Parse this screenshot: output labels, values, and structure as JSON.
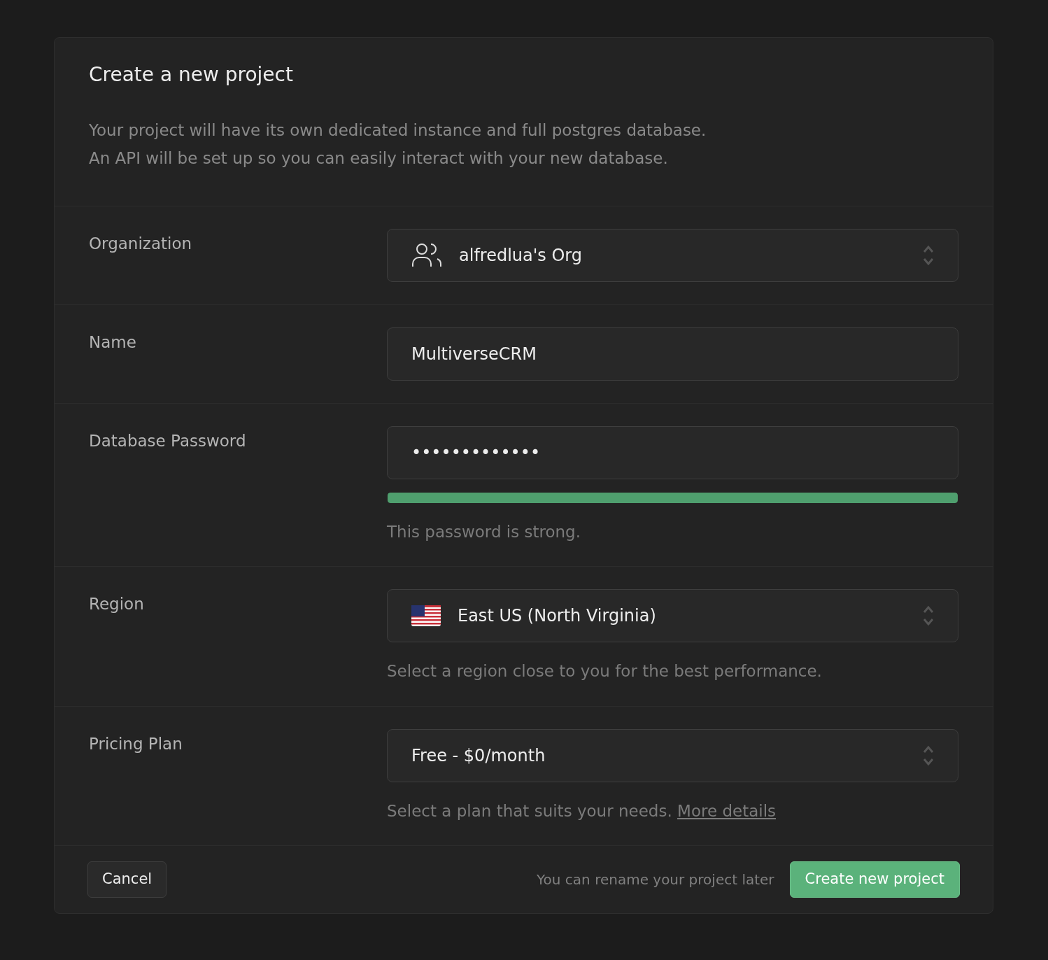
{
  "title": "Create a new project",
  "description": [
    "Your project will have its own dedicated instance and full postgres database.",
    "An API will be set up so you can easily interact with your new database."
  ],
  "fields": [
    {
      "kind": "org-select",
      "label": "Organization",
      "value": "alfredlua's Org"
    },
    {
      "kind": "text",
      "label": "Name",
      "value": "MultiverseCRM"
    },
    {
      "kind": "password",
      "label": "Database Password",
      "value": "•••••••••••••",
      "strength": {
        "level": 1,
        "color": "#4f9f6e"
      },
      "help": "This password is strong."
    },
    {
      "kind": "region-select",
      "label": "Region",
      "value": "East US (North Virginia)",
      "help": "Select a region close to you for the best performance."
    },
    {
      "kind": "plan-select",
      "label": "Pricing Plan",
      "value": "Free - $0/month",
      "help": "Select a plan that suits your needs.",
      "link": "More details"
    }
  ],
  "footer": {
    "cancel": "Cancel",
    "note": "You can rename your project later",
    "submit": "Create new project"
  }
}
